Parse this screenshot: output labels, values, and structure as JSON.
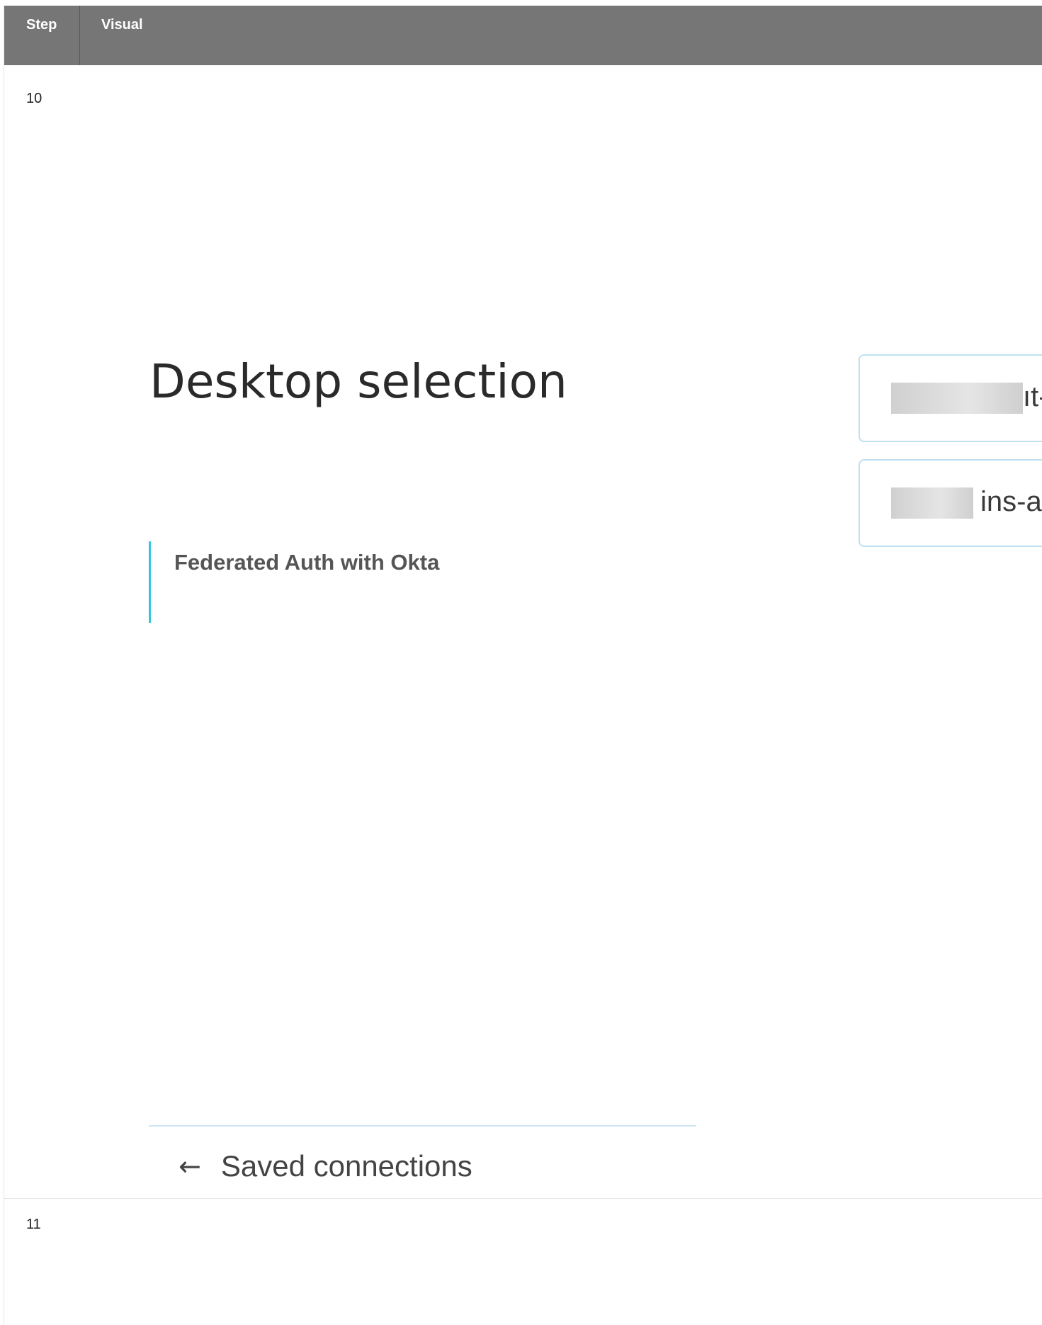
{
  "table": {
    "headers": {
      "step": "Step",
      "visual": "Visual"
    },
    "rows": [
      {
        "step": "10"
      },
      {
        "step": "11"
      }
    ]
  },
  "screen": {
    "title": "Desktop selection",
    "section_label": "Federated Auth with Okta",
    "desktop_items": [
      {
        "visible_text": "ıt-"
      },
      {
        "visible_text": "ins-a"
      }
    ],
    "back_link": {
      "icon": "arrow-left-icon",
      "arrow_glyph": "←",
      "label": "Saved connections"
    }
  },
  "colors": {
    "header_bg": "#767676",
    "accent": "#35c8dc",
    "card_border": "#bfe0f3"
  }
}
